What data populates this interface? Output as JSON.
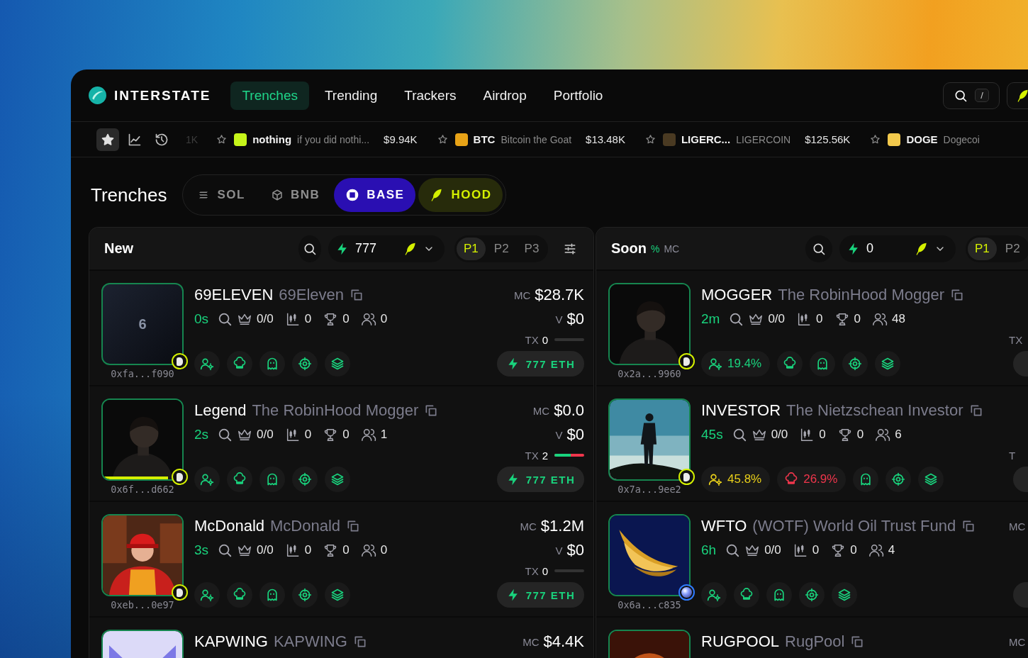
{
  "nav": {
    "logo": "INTERSTATE",
    "tabs": [
      {
        "label": "Trenches",
        "selected": true
      },
      {
        "label": "Trending",
        "selected": false
      },
      {
        "label": "Trackers",
        "selected": false
      },
      {
        "label": "Airdrop",
        "selected": false
      },
      {
        "label": "Portfolio",
        "selected": false
      }
    ],
    "search_shortcut": "/"
  },
  "ticker": {
    "views": [
      {
        "selected": true
      },
      {
        "selected": false
      },
      {
        "selected": false
      }
    ],
    "faded_price": "1K",
    "items": [
      {
        "symbol": "nothing",
        "name": "if you did nothi...",
        "price": "$9.94K",
        "color": "#c6f51a"
      },
      {
        "symbol": "BTC",
        "name": "Bitcoin the Goat",
        "price": "$13.48K",
        "color": "#e8a317"
      },
      {
        "symbol": "LIGERC...",
        "name": "LIGERCOIN",
        "price": "$125.56K",
        "color": "#4a3a22"
      },
      {
        "symbol": "DOGE",
        "name": "Dogecoi",
        "color": "#f2c94c"
      }
    ]
  },
  "page_title": "Trenches",
  "chains": [
    {
      "label": "SOL",
      "selected": false
    },
    {
      "label": "BNB",
      "selected": false
    },
    {
      "label": "BASE",
      "selected": true,
      "color": "#2a0fb2"
    },
    {
      "label": "HOOD",
      "selected": false,
      "color": "#d4f000"
    }
  ],
  "columns": [
    {
      "title": "New",
      "speed": "777",
      "filter_button": true,
      "presets": [
        {
          "label": "P1",
          "selected": true
        },
        {
          "label": "P2",
          "selected": false
        },
        {
          "label": "P3",
          "selected": false
        }
      ],
      "rows": [
        {
          "avatar": {
            "kind": "letter",
            "text": "6"
          },
          "badge": {
            "kind": "pill",
            "color": "#d4f000"
          },
          "address": "0xfa...f090",
          "name": "69ELEVEN",
          "full_name": "69Eleven",
          "age": "0s",
          "crown": "0/0",
          "candles": "0",
          "trophy": "0",
          "holders": "0",
          "chips": [
            {
              "kind": "holders-gear",
              "color": "#19d37d"
            },
            {
              "kind": "chef",
              "color": "#19d37d"
            },
            {
              "kind": "ghost",
              "color": "#19d37d"
            },
            {
              "kind": "target",
              "color": "#19d37d"
            },
            {
              "kind": "layers",
              "color": "#19d37d"
            }
          ],
          "side": {
            "mc_label": "MC",
            "mc": "$28.7K",
            "v_label": "V",
            "v": "$0",
            "tx_label": "TX",
            "tx": "0",
            "buy_button": true,
            "buy": "777 ETH"
          }
        },
        {
          "avatar": {
            "kind": "picture",
            "level": 0.82
          },
          "badge": {
            "kind": "pill",
            "color": "#d4f000"
          },
          "address": "0x6f...d662",
          "name": "Legend",
          "full_name": "The RobinHood Mogger",
          "age": "2s",
          "crown": "0/0",
          "candles": "0",
          "trophy": "0",
          "holders": "1",
          "chips": [
            {
              "kind": "holders-gear",
              "color": "#19d37d"
            },
            {
              "kind": "chef",
              "color": "#19d37d"
            },
            {
              "kind": "ghost",
              "color": "#19d37d"
            },
            {
              "kind": "target",
              "color": "#19d37d"
            },
            {
              "kind": "layers",
              "color": "#19d37d"
            }
          ],
          "side": {
            "mc_label": "MC",
            "mc": "$0.0",
            "v_label": "V",
            "v": "$0",
            "tx_label": "TX",
            "tx": "2",
            "level": 0.55,
            "buy_button": true,
            "buy": "777 ETH"
          }
        },
        {
          "badge": {
            "kind": "pill",
            "color": "#d4f000"
          },
          "address": "0xeb...0e97",
          "name": "McDonald",
          "full_name": "McDonald",
          "age": "3s",
          "crown": "0/0",
          "candles": "0",
          "trophy": "0",
          "holders": "0",
          "chips": [
            {
              "kind": "holders-gear",
              "color": "#19d37d"
            },
            {
              "kind": "chef",
              "color": "#19d37d"
            },
            {
              "kind": "ghost",
              "color": "#19d37d"
            },
            {
              "kind": "target",
              "color": "#19d37d"
            },
            {
              "kind": "layers",
              "color": "#19d37d"
            }
          ],
          "side": {
            "mc_label": "MC",
            "mc": "$1.2M",
            "v_label": "V",
            "v": "$0",
            "tx_label": "TX",
            "tx": "0",
            "buy_button": true,
            "buy": "777 ETH"
          }
        },
        {
          "name": "KAPWING",
          "full_name": "KAPWING",
          "side": {
            "mc_label": "MC",
            "mc": "$4.4K"
          }
        }
      ]
    },
    {
      "title": "Soon",
      "tags": [
        {
          "label": "%",
          "color": "#19d37d"
        },
        {
          "label": "MC",
          "color": "#8b8b98"
        }
      ],
      "speed": "0",
      "presets": [
        {
          "label": "P1",
          "selected": true
        },
        {
          "label": "P2",
          "selected": false
        }
      ],
      "rows": [
        {
          "badge": {
            "kind": "pill",
            "color": "#d4f000"
          },
          "address": "0x2a...9960",
          "name": "MOGGER",
          "full_name": "The RobinHood Mogger",
          "age": "2m",
          "crown": "0/0",
          "candles": "0",
          "trophy": "0",
          "holders": "48",
          "chips": [
            {
              "kind": "holders-gear",
              "value": "19.4%",
              "color": "#19d37d"
            },
            {
              "kind": "chef",
              "color": "#19d37d"
            },
            {
              "kind": "ghost",
              "color": "#19d37d"
            },
            {
              "kind": "target",
              "color": "#19d37d"
            },
            {
              "kind": "layers",
              "color": "#19d37d"
            }
          ],
          "side": {
            "tx_label": "TX",
            "buy_button": true
          }
        },
        {
          "badge": {
            "kind": "pill",
            "color": "#d4f000"
          },
          "address": "0x7a...9ee2",
          "name": "INVESTOR",
          "full_name": "The Nietzschean Investor",
          "age": "45s",
          "crown": "0/0",
          "candles": "0",
          "trophy": "0",
          "holders": "6",
          "chips": [
            {
              "kind": "holders-gear",
              "value": "45.8%",
              "color": "#e8cf1a"
            },
            {
              "kind": "chef",
              "value": "26.9%",
              "color": "#f0364c"
            },
            {
              "kind": "ghost",
              "color": "#19d37d"
            },
            {
              "kind": "target",
              "color": "#19d37d"
            },
            {
              "kind": "layers",
              "color": "#19d37d"
            }
          ],
          "side": {
            "tx_label": "T",
            "buy_button": true
          }
        },
        {
          "badge": {
            "kind": "orb",
            "color": "#2f7bff"
          },
          "address": "0x6a...c835",
          "name": "WFTO",
          "full_name": "(WOTF) World Oil Trust Fund",
          "age": "6h",
          "crown": "0/0",
          "candles": "0",
          "trophy": "0",
          "holders": "4",
          "chips": [
            {
              "kind": "holders-gear",
              "color": "#19d37d"
            },
            {
              "kind": "chef",
              "color": "#19d37d"
            },
            {
              "kind": "ghost",
              "color": "#19d37d"
            },
            {
              "kind": "target",
              "color": "#19d37d"
            },
            {
              "kind": "layers",
              "color": "#19d37d"
            }
          ],
          "side": {
            "mc_label": "MC",
            "buy_button": true
          }
        },
        {
          "name": "RUGPOOL",
          "full_name": "RugPool",
          "side": {
            "mc_label": "MC"
          }
        }
      ]
    }
  ]
}
